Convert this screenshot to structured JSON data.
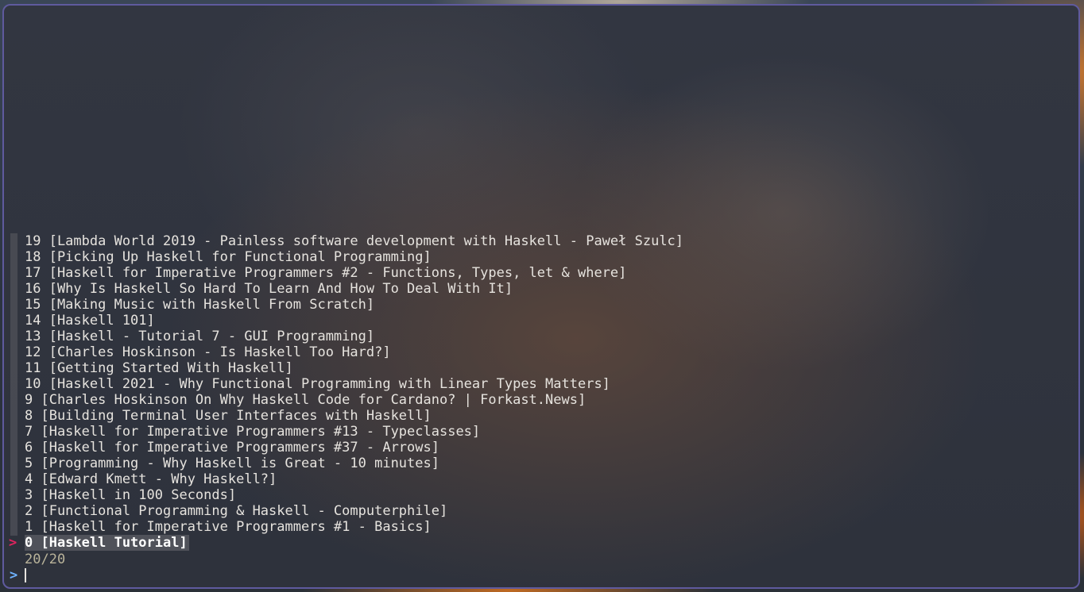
{
  "finder": {
    "items": [
      "19 [Lambda World 2019 - Painless software development with Haskell - Paweł Szulc]",
      "18 [Picking Up Haskell for Functional Programming]",
      "17 [Haskell for Imperative Programmers #2 - Functions, Types, let & where]",
      "16 [Why Is Haskell So Hard To Learn And How To Deal With It]",
      "15 [Making Music with Haskell From Scratch]",
      "14 [Haskell 101]",
      "13 [Haskell - Tutorial 7 - GUI Programming]",
      "12 [Charles Hoskinson - Is Haskell Too Hard?]",
      "11 [Getting Started With Haskell]",
      "10 [Haskell 2021 - Why Functional Programming with Linear Types Matters]",
      "9 [Charles Hoskinson On Why Haskell Code for Cardano? | Forkast.News]",
      "8 [Building Terminal User Interfaces with Haskell]",
      "7 [Haskell for Imperative Programmers #13 - Typeclasses]",
      "6 [Haskell for Imperative Programmers #37 - Arrows]",
      "5 [Programming - Why Haskell is Great - 10 minutes]",
      "4 [Edward Kmett - Why Haskell?]",
      "3 [Haskell in 100 Seconds]",
      "2 [Functional Programming & Haskell - Computerphile]",
      "1 [Haskell for Imperative Programmers #1 - Basics]",
      "0 [Haskell Tutorial]"
    ],
    "selected_index": 19,
    "pointer": ">",
    "count": "20/20",
    "prompt": ">",
    "query": ""
  },
  "colors": {
    "border": "#5f5a9e",
    "pointer": "#e0245e",
    "prompt": "#6fb3ff",
    "info": "#b9b39a",
    "text": "#e6e3de"
  }
}
